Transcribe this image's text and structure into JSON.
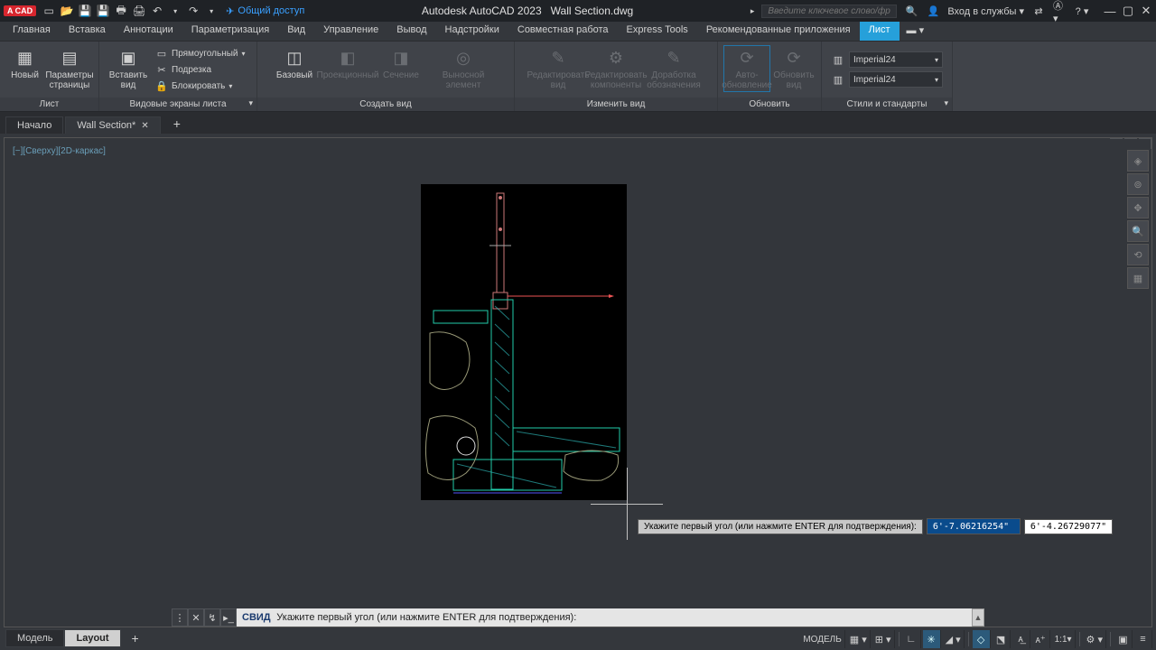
{
  "app": {
    "badge": "A CAD",
    "title": "Autodesk AutoCAD 2023",
    "filename": "Wall Section.dwg",
    "search_placeholder": "Введите ключевое слово/фразу",
    "sign_in": "Вход в службы",
    "share": "Общий доступ"
  },
  "ribbon_tabs": [
    "Главная",
    "Вставка",
    "Аннотации",
    "Параметризация",
    "Вид",
    "Управление",
    "Вывод",
    "Надстройки",
    "Совместная работа",
    "Express Tools",
    "Рекомендованные приложения",
    "Лист"
  ],
  "ribbon_active": "Лист",
  "panels": {
    "layout": {
      "title": "Лист",
      "new": "Новый",
      "page_setup": "Параметры страницы",
      "insert_view": "Вставить вид",
      "rect": "Прямоугольный",
      "clip": "Подрезка",
      "lock": "Блокировать"
    },
    "layout_viewports": {
      "title": "Видовые экраны листа"
    },
    "create_view": {
      "title": "Создать вид",
      "base": "Базовый",
      "projected": "Проекционный",
      "section": "Сечение",
      "detail": "Выносной элемент"
    },
    "modify_view": {
      "title": "Изменить вид",
      "edit_view": "Редактировать вид",
      "edit_components": "Редактировать компоненты",
      "symbol_sketch": "Доработка обозначения"
    },
    "update": {
      "title": "Обновить",
      "auto": "Авто-\nобновление",
      "update_view": "Обновить вид"
    },
    "styles": {
      "title": "Стили и стандарты",
      "style1": "Imperial24",
      "style2": "Imperial24"
    }
  },
  "file_tabs": {
    "start": "Начало",
    "active": "Wall Section*"
  },
  "viewport_label": "[−][Сверху][2D-каркас]",
  "dynamic_input": {
    "prompt": "Укажите первый угол (или нажмите ENTER для подтверждения):",
    "x": "6'-7.06216254\"",
    "y": "6'-4.26729077\""
  },
  "command": {
    "cmd": "СВИД",
    "prompt": "Укажите первый угол (или нажмите ENTER для подтверждения):"
  },
  "bottom_tabs": {
    "model": "Модель",
    "layout": "Layout"
  },
  "status": {
    "space": "МОДЕЛЬ",
    "scale": "1:1"
  }
}
